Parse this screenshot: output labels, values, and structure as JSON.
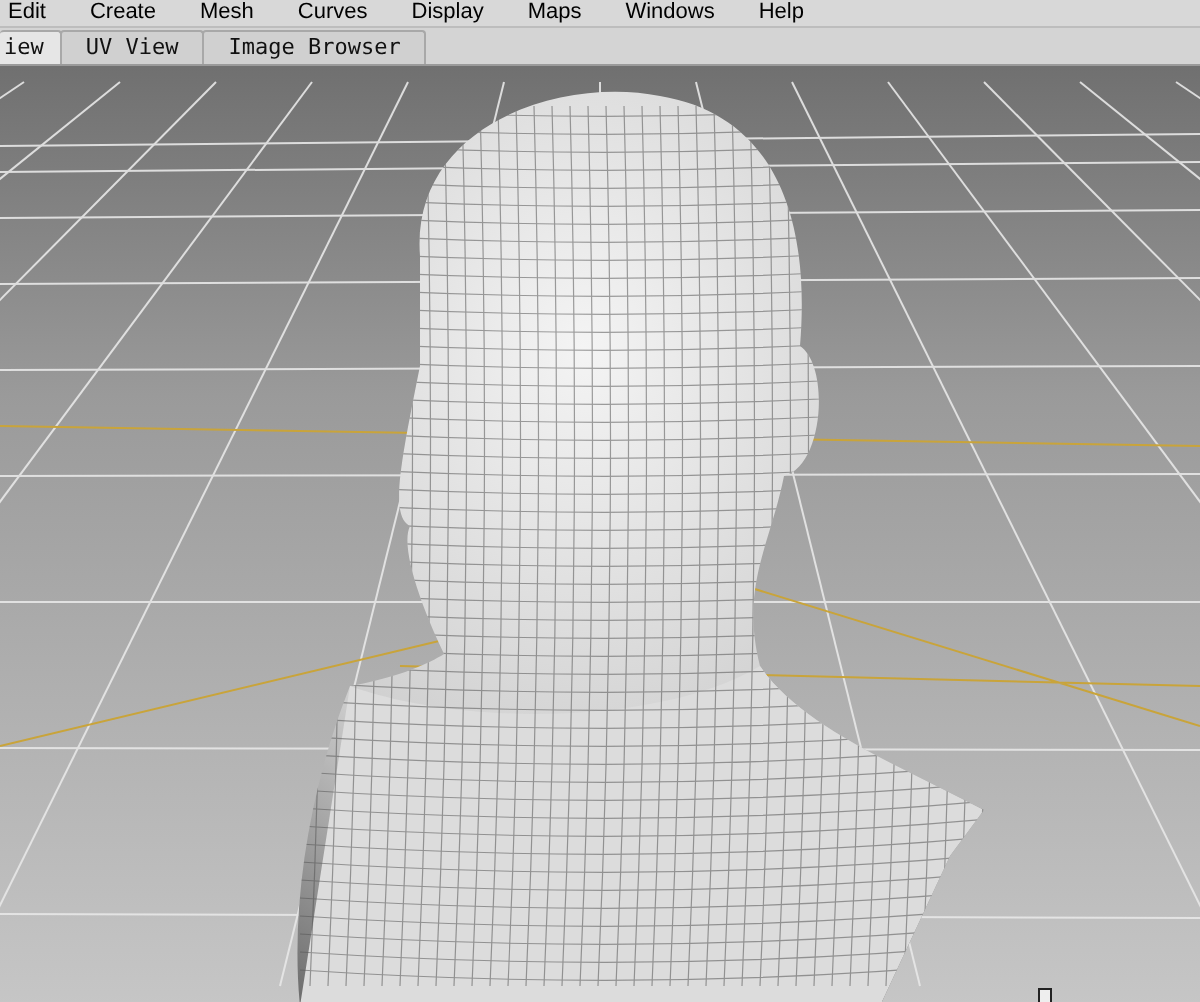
{
  "menu_bar": {
    "items": [
      "Edit",
      "Create",
      "Mesh",
      "Curves",
      "Display",
      "Maps",
      "Windows",
      "Help"
    ]
  },
  "tabs": [
    {
      "label": "iew",
      "selected": true
    },
    {
      "label": "UV View",
      "selected": false
    },
    {
      "label": "Image Browser",
      "selected": false
    }
  ]
}
